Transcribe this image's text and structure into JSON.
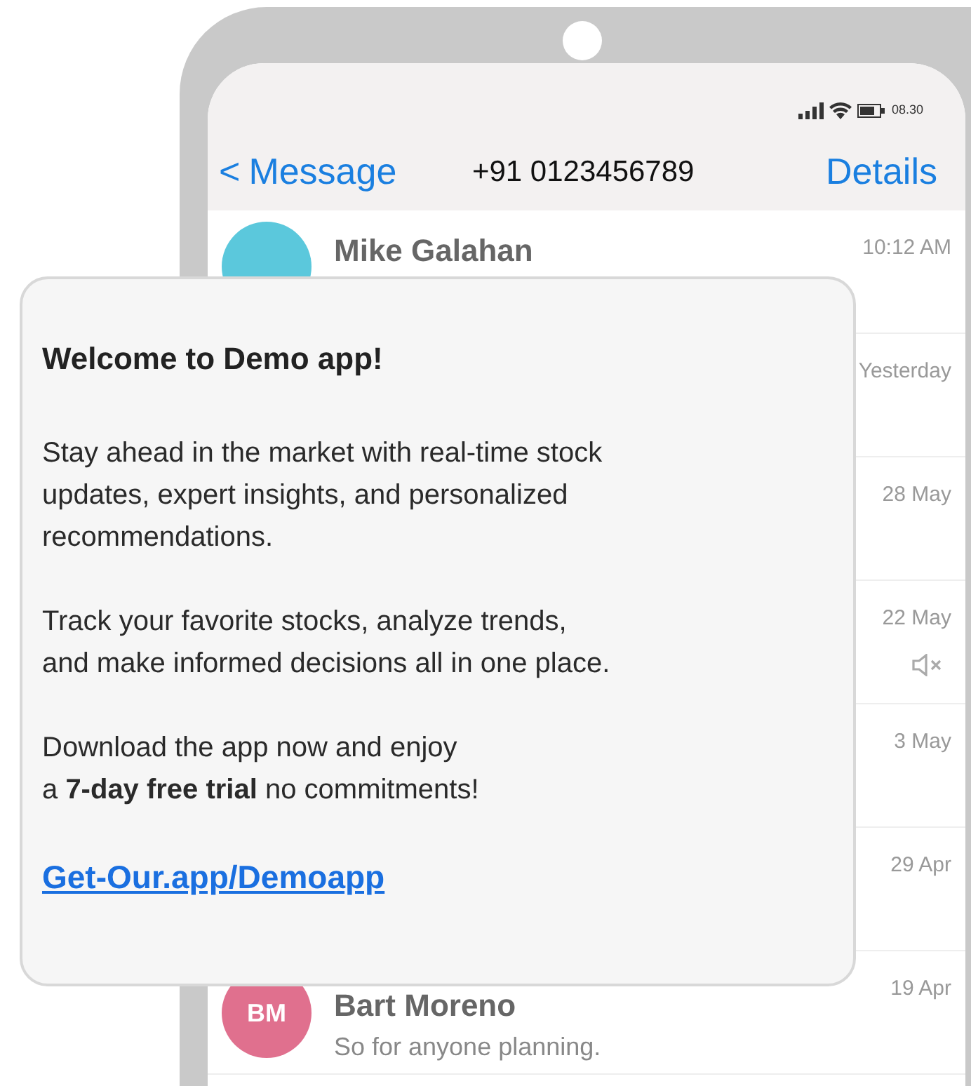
{
  "status_bar": {
    "time": "08.30"
  },
  "header": {
    "back": "<",
    "back_label": "Message",
    "title": "+91 0123456789",
    "action": "Details"
  },
  "conversations": [
    {
      "name": "Mike Galahan",
      "time": "10:12 AM",
      "color": "#5bc8dc",
      "muted": false
    },
    {
      "time": "Yesterday",
      "muted": false
    },
    {
      "time": "28 May",
      "muted": false
    },
    {
      "time": "22 May",
      "muted": true
    },
    {
      "time": "3 May",
      "muted": false
    },
    {
      "time": "29 Apr",
      "muted": false
    },
    {
      "name": "Bart Moreno",
      "preview": "So for anyone planning.",
      "time": "19 Apr",
      "initials": "BM",
      "color": "#e0708e",
      "muted": false
    }
  ],
  "popup": {
    "title": "Welcome to Demo app!",
    "paragraphs": [
      [
        "Stay ahead in the market with real-time stock",
        "updates, expert insights, and personalized",
        "recommendations."
      ],
      [
        "Track your favorite stocks, analyze trends,",
        "and make informed decisions all in one place."
      ],
      [
        "Download the app now and enjoy",
        "a **7-day free trial** no commitments!"
      ]
    ],
    "link": "Get-Our.app/Demoapp"
  }
}
